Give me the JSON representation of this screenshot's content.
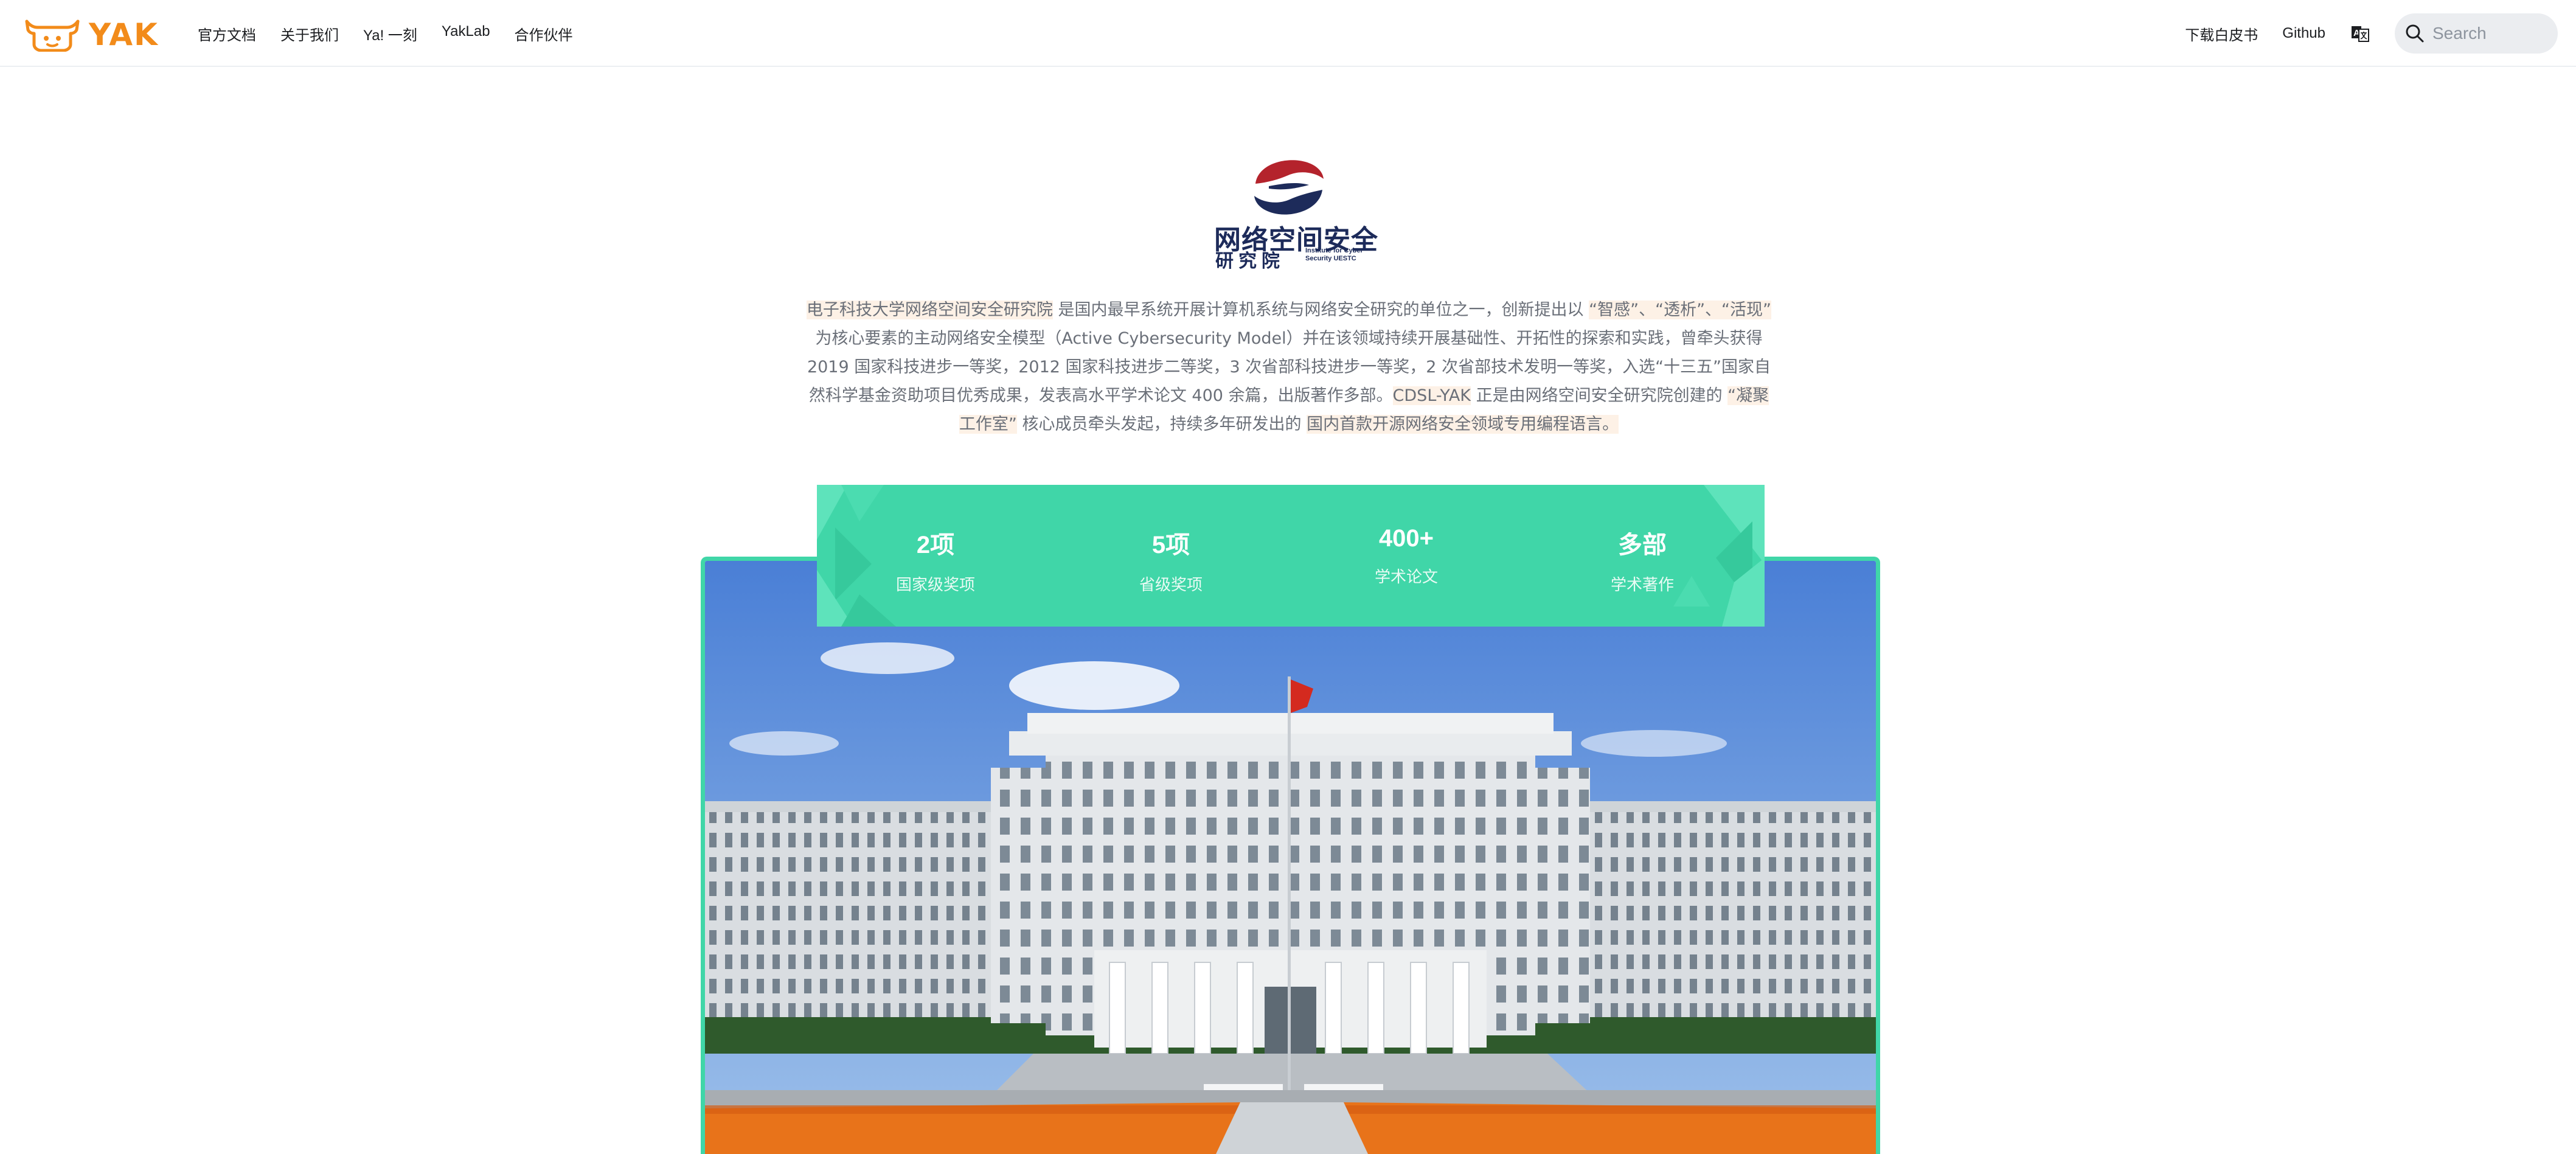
{
  "navbar": {
    "logo_text": "YAK",
    "links": [
      "官方文档",
      "关于我们",
      "Ya! 一刻",
      "YakLab",
      "合作伙伴"
    ],
    "right_links": [
      "下载白皮书",
      "Github"
    ],
    "search": {
      "placeholder": "Search"
    }
  },
  "institute": {
    "name_cn_top": "网络空间安全",
    "name_cn_bottom": "研究院",
    "name_en": [
      "Institute for Cyber",
      "Security    UESTC"
    ]
  },
  "description": {
    "p1": "电子科技大学网络空间安全研究院",
    "p2": " 是国内最早系统开展计算机系统与网络安全研究的单位之一，创新提出以 ",
    "p3": "“智感”、“透析”、“活现”",
    "p4": " 为核心要素的主动网络安全模型（Active Cybersecurity Model）并在该领域持续开展基础性、开拓性的探索和实践，曾牵头获得 2019 国家科技进步一等奖，2012 国家科技进步二等奖，3 次省部科技进步一等奖，2 次省部技术发明一等奖，入选“十三五”国家自然科学基金资助项目优秀成果，发表高水平学术论文 400 余篇，出版著作多部。",
    "p5": "CDSL-YAK",
    "p6": " 正是由网络空间安全研究院创建的 ",
    "p7": "“凝聚工作室”",
    "p8": " 核心成员牵头发起，持续多年研发出的 ",
    "p9": "国内首款开源网络安全领域专用编程语言",
    "p10": "。"
  },
  "stats": [
    {
      "value": "2项",
      "label": "国家级奖项"
    },
    {
      "value": "5项",
      "label": "省级奖项"
    },
    {
      "value": "400+",
      "label": "学术论文"
    },
    {
      "value": "多部",
      "label": "学术著作"
    }
  ],
  "colors": {
    "brand_orange": "#f28b1a",
    "accent_green": "#40d6a8",
    "institute_navy": "#1d2b5a",
    "institute_red": "#b4232c",
    "highlight_bg": "#fdf1e6"
  }
}
